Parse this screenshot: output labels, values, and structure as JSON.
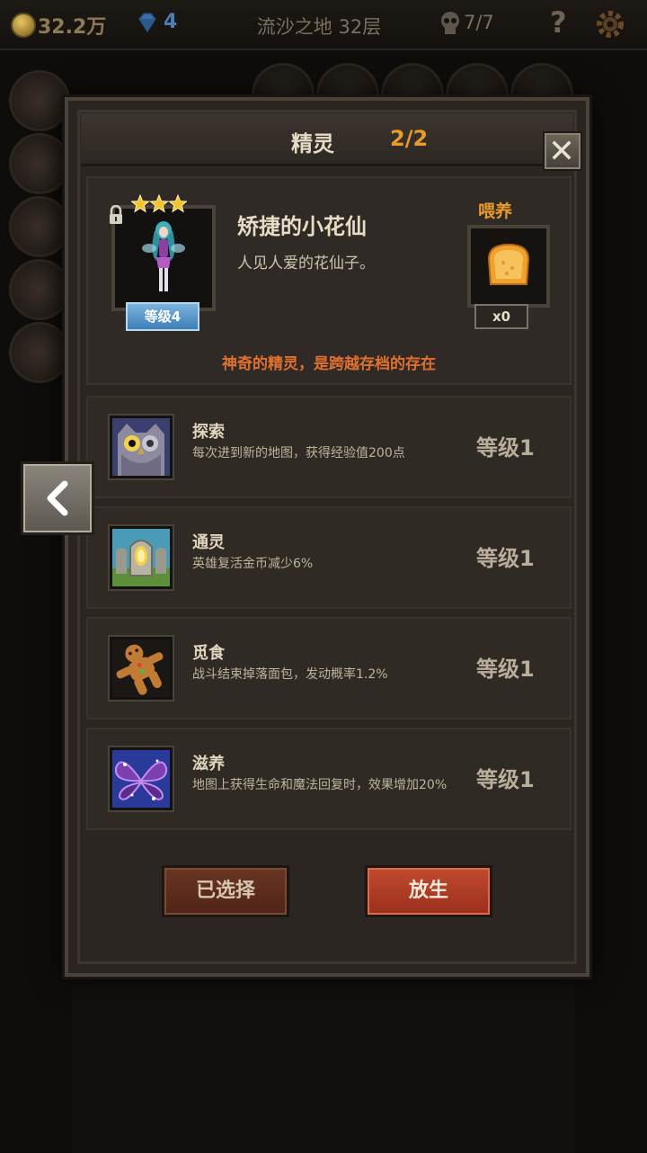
{
  "status_bar": {
    "gold": "32.2万",
    "gems": "4",
    "floor": "流沙之地 32层",
    "lives": "7/7",
    "help": "?"
  },
  "dialog": {
    "title": "精灵",
    "count": "2/2",
    "sprite": {
      "name": "矫捷的小花仙",
      "description": "人见人爱的花仙子。",
      "level": "等级4",
      "stars": 3,
      "tagline": "神奇的精灵，是跨越存档的存在"
    },
    "feed": {
      "label": "喂养",
      "count": "x0"
    },
    "skills": [
      {
        "name": "探索",
        "description": "每次进到新的地图，获得经验值200点",
        "level": "等级1",
        "icon": "owl-icon"
      },
      {
        "name": "通灵",
        "description": "英雄复活金币减少6%",
        "level": "等级1",
        "icon": "tombstone-icon"
      },
      {
        "name": "觅食",
        "description": "战斗结束掉落面包，发动概率1.2%",
        "level": "等级1",
        "icon": "gingerbread-icon"
      },
      {
        "name": "滋养",
        "description": "地图上获得生命和魔法回复时，效果增加20%",
        "level": "等级1",
        "icon": "fairy-wings-icon"
      }
    ],
    "buttons": {
      "selected": "已选择",
      "release": "放生"
    }
  },
  "colors": {
    "accent_orange": "#e89a2a",
    "tagline_red": "#e0702f",
    "level_badge": "#4f8fc4"
  }
}
